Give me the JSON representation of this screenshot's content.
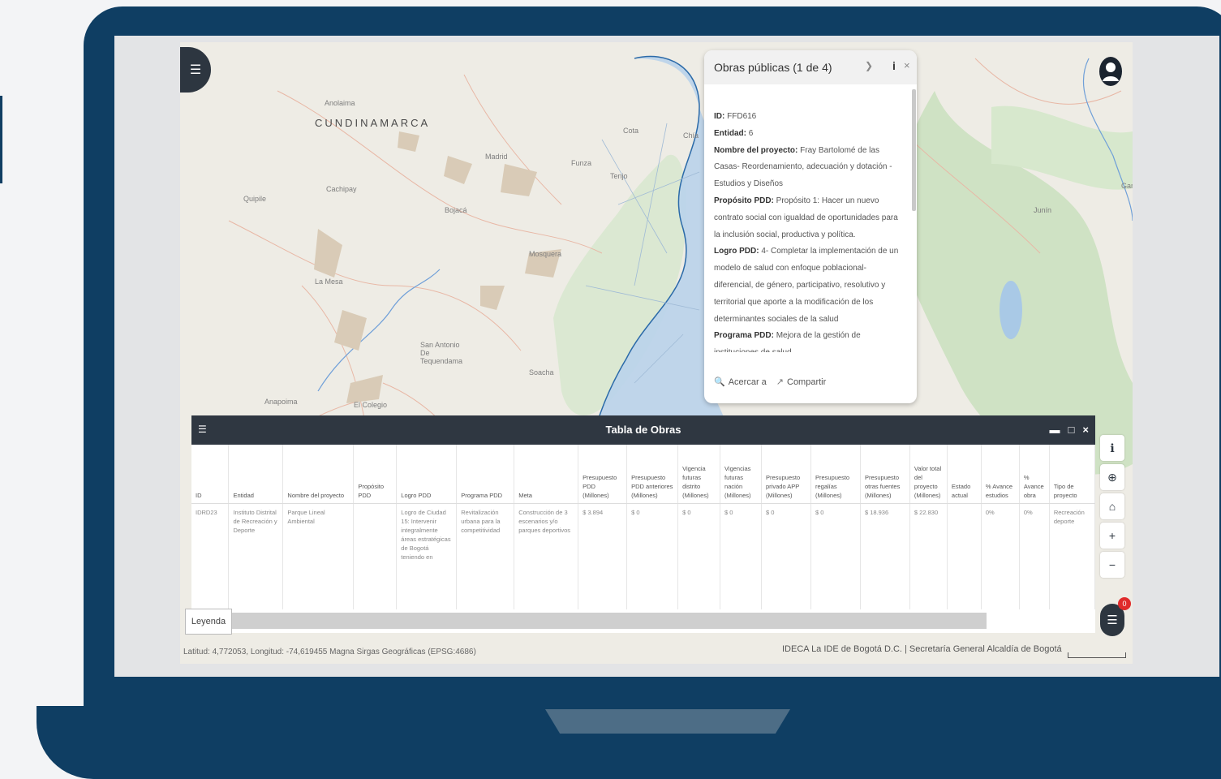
{
  "popup": {
    "title": "Obras públicas (1 de 4)",
    "fields": [
      {
        "label": "ID:",
        "value": "FFD616"
      },
      {
        "label": "Entidad:",
        "value": "6"
      },
      {
        "label": "Nombre del proyecto:",
        "value": "Fray Bartolomé de las Casas- Reordenamiento, adecuación y dotación - Estudios y Diseños"
      },
      {
        "label": "Propósito PDD:",
        "value": "Propósito 1: Hacer un nuevo contrato social con igualdad de oportunidades para la inclusión social, productiva y política."
      },
      {
        "label": "Logro PDD:",
        "value": "4- Completar la implementación de un modelo de salud con enfoque poblacional-diferencial, de género, participativo, resolutivo y territorial que aporte a la modificación de los determinantes sociales de la salud"
      },
      {
        "label": "Programa PDD:",
        "value": "Mejora de la gestión de instituciones de salud"
      }
    ],
    "zoom_label": "Acercar a",
    "share_label": "Compartir"
  },
  "map": {
    "labels": [
      "CUNDINAMARCA",
      "Anolaima",
      "Quipile",
      "Cachipay",
      "Bojacá",
      "Madrid",
      "Funza",
      "Tenjo",
      "Chía",
      "Cota",
      "La Mesa",
      "Mosquera",
      "Soacha",
      "San Antonio De Tequendama",
      "El Colegio",
      "Anapoima",
      "Junín",
      "Gama"
    ]
  },
  "table": {
    "title": "Tabla de Obras",
    "columns": [
      "ID",
      "Entidad",
      "Nombre del proyecto",
      "Propósito PDD",
      "Logro PDD",
      "Programa PDD",
      "Meta",
      "Presupuesto PDD (Millones)",
      "Presupuesto PDD anteriores (Millones)",
      "Vigencia futuras distrito (Millones)",
      "Vigencias futuras nación (Millones)",
      "Presupuesto privado APP (Millones)",
      "Presupuesto regalías (Millones)",
      "Presupuesto otras fuentes (Millones)",
      "Valor total del proyecto (Millones)",
      "Estado actual",
      "% Avance estudios",
      "% Avance obra",
      "Tipo de proyecto"
    ],
    "rows": [
      [
        "IDRD23",
        "Instituto Distrital de Recreación y Deporte",
        "Parque Lineal Ambiental",
        "",
        "Logro de Ciudad 15: Intervenir integralmente áreas estratégicas de Bogotá teniendo en",
        "Revitalización urbana para la competitividad",
        "Construcción de 3 escenarios y/o parques deportivos",
        "$ 3.894",
        "$ 0",
        "$ 0",
        "$ 0",
        "$ 0",
        "$ 0",
        "$ 18.936",
        "$ 22.830",
        "",
        "0%",
        "0%",
        "Recreación deporte"
      ]
    ]
  },
  "legend_label": "Leyenda",
  "layers_badge": "0",
  "status": {
    "coords": "Latitud: 4,772053, Longitud: -74,619455 Magna Sirgas Geográficas (EPSG:4686)",
    "attribution": "IDECA La IDE de Bogotá D.C. | Secretaría General Alcaldía de Bogotá"
  }
}
